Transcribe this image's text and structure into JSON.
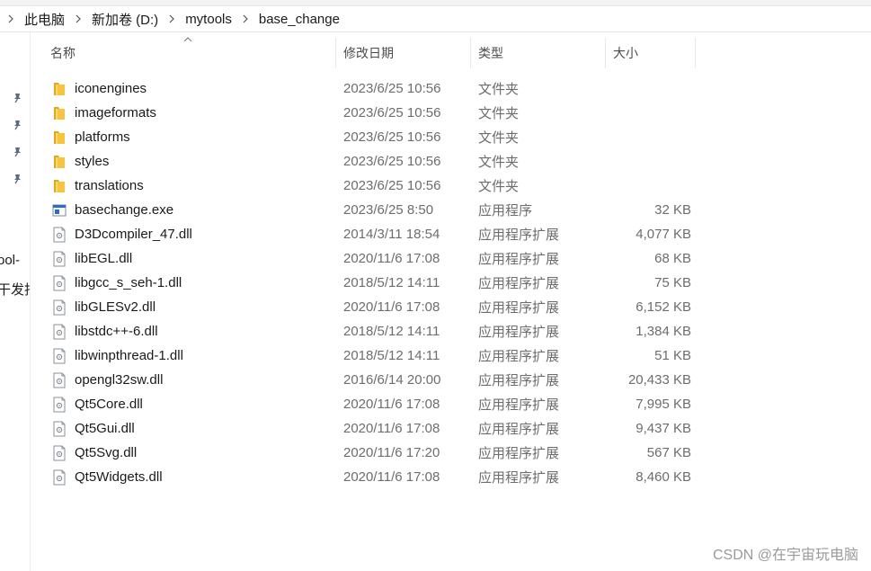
{
  "breadcrumb": [
    "此电脑",
    "新加卷 (D:)",
    "mytools",
    "base_change"
  ],
  "nav_fragments": [
    "ool-",
    "干发指"
  ],
  "columns": {
    "name": "名称",
    "date": "修改日期",
    "type": "类型",
    "size": "大小"
  },
  "files": [
    {
      "name": "iconengines",
      "date": "2023/6/25 10:56",
      "type": "文件夹",
      "size": "",
      "kind": "folder"
    },
    {
      "name": "imageformats",
      "date": "2023/6/25 10:56",
      "type": "文件夹",
      "size": "",
      "kind": "folder"
    },
    {
      "name": "platforms",
      "date": "2023/6/25 10:56",
      "type": "文件夹",
      "size": "",
      "kind": "folder"
    },
    {
      "name": "styles",
      "date": "2023/6/25 10:56",
      "type": "文件夹",
      "size": "",
      "kind": "folder"
    },
    {
      "name": "translations",
      "date": "2023/6/25 10:56",
      "type": "文件夹",
      "size": "",
      "kind": "folder"
    },
    {
      "name": "basechange.exe",
      "date": "2023/6/25 8:50",
      "type": "应用程序",
      "size": "32 KB",
      "kind": "exe"
    },
    {
      "name": "D3Dcompiler_47.dll",
      "date": "2014/3/11 18:54",
      "type": "应用程序扩展",
      "size": "4,077 KB",
      "kind": "dll"
    },
    {
      "name": "libEGL.dll",
      "date": "2020/11/6 17:08",
      "type": "应用程序扩展",
      "size": "68 KB",
      "kind": "dll"
    },
    {
      "name": "libgcc_s_seh-1.dll",
      "date": "2018/5/12 14:11",
      "type": "应用程序扩展",
      "size": "75 KB",
      "kind": "dll"
    },
    {
      "name": "libGLESv2.dll",
      "date": "2020/11/6 17:08",
      "type": "应用程序扩展",
      "size": "6,152 KB",
      "kind": "dll"
    },
    {
      "name": "libstdc++-6.dll",
      "date": "2018/5/12 14:11",
      "type": "应用程序扩展",
      "size": "1,384 KB",
      "kind": "dll"
    },
    {
      "name": "libwinpthread-1.dll",
      "date": "2018/5/12 14:11",
      "type": "应用程序扩展",
      "size": "51 KB",
      "kind": "dll"
    },
    {
      "name": "opengl32sw.dll",
      "date": "2016/6/14 20:00",
      "type": "应用程序扩展",
      "size": "20,433 KB",
      "kind": "dll"
    },
    {
      "name": "Qt5Core.dll",
      "date": "2020/11/6 17:08",
      "type": "应用程序扩展",
      "size": "7,995 KB",
      "kind": "dll"
    },
    {
      "name": "Qt5Gui.dll",
      "date": "2020/11/6 17:08",
      "type": "应用程序扩展",
      "size": "9,437 KB",
      "kind": "dll"
    },
    {
      "name": "Qt5Svg.dll",
      "date": "2020/11/6 17:20",
      "type": "应用程序扩展",
      "size": "567 KB",
      "kind": "dll"
    },
    {
      "name": "Qt5Widgets.dll",
      "date": "2020/11/6 17:08",
      "type": "应用程序扩展",
      "size": "8,460 KB",
      "kind": "dll"
    }
  ],
  "watermark": "CSDN @在宇宙玩电脑",
  "colors": {
    "folder": "#f5c542",
    "folder_dark": "#e0a81c",
    "exe_blue": "#2b6cc4"
  }
}
